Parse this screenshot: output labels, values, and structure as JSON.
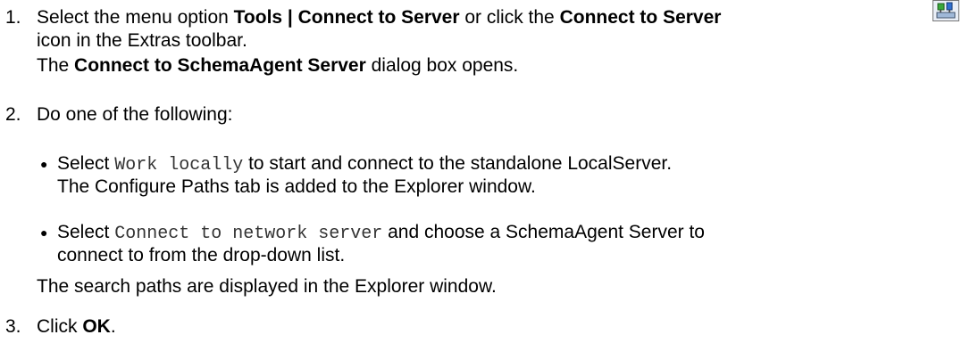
{
  "steps": [
    {
      "number": "1.",
      "line1": {
        "pre": "Select the menu option ",
        "menu": "Tools | Connect to Server",
        "mid": " or click the ",
        "button": "Connect to Server"
      },
      "line2": "icon in the Extras toolbar.",
      "line3": {
        "pre": "The ",
        "dialog": "Connect to SchemaAgent Server",
        "post": " dialog box opens."
      }
    },
    {
      "number": "2.",
      "text": "Do one of the following:",
      "options": [
        {
          "code": "Work locally",
          "text": " to start and connect to the standalone LocalServer.",
          "line2": "The Configure Paths tab is added to the Explorer window."
        },
        {
          "code": "Connect to network server",
          "text": " and choose a SchemaAgent Server to",
          "line2": "connect to from the drop-down list."
        }
      ],
      "select_word": "Select ",
      "note": "The search paths are displayed in the Explorer window."
    },
    {
      "number": "3.",
      "pre": "Click ",
      "bold": "OK",
      "post": "."
    }
  ],
  "icons": {
    "toolbar_icon": "connect-to-server-icon"
  }
}
